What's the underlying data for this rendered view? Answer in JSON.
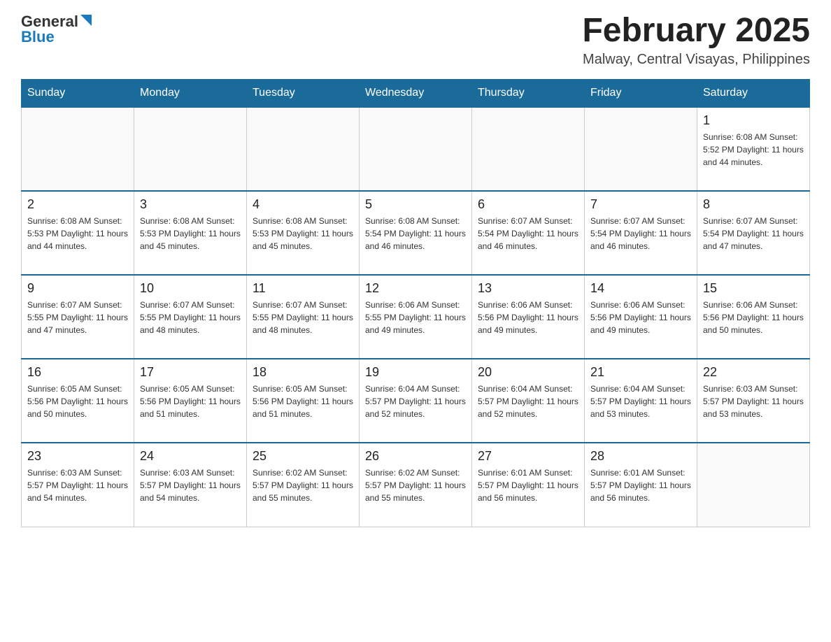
{
  "header": {
    "logo": {
      "general": "General",
      "blue": "Blue"
    },
    "title": "February 2025",
    "subtitle": "Malway, Central Visayas, Philippines"
  },
  "weekdays": [
    "Sunday",
    "Monday",
    "Tuesday",
    "Wednesday",
    "Thursday",
    "Friday",
    "Saturday"
  ],
  "weeks": [
    [
      {
        "day": "",
        "info": ""
      },
      {
        "day": "",
        "info": ""
      },
      {
        "day": "",
        "info": ""
      },
      {
        "day": "",
        "info": ""
      },
      {
        "day": "",
        "info": ""
      },
      {
        "day": "",
        "info": ""
      },
      {
        "day": "1",
        "info": "Sunrise: 6:08 AM\nSunset: 5:52 PM\nDaylight: 11 hours and 44 minutes."
      }
    ],
    [
      {
        "day": "2",
        "info": "Sunrise: 6:08 AM\nSunset: 5:53 PM\nDaylight: 11 hours and 44 minutes."
      },
      {
        "day": "3",
        "info": "Sunrise: 6:08 AM\nSunset: 5:53 PM\nDaylight: 11 hours and 45 minutes."
      },
      {
        "day": "4",
        "info": "Sunrise: 6:08 AM\nSunset: 5:53 PM\nDaylight: 11 hours and 45 minutes."
      },
      {
        "day": "5",
        "info": "Sunrise: 6:08 AM\nSunset: 5:54 PM\nDaylight: 11 hours and 46 minutes."
      },
      {
        "day": "6",
        "info": "Sunrise: 6:07 AM\nSunset: 5:54 PM\nDaylight: 11 hours and 46 minutes."
      },
      {
        "day": "7",
        "info": "Sunrise: 6:07 AM\nSunset: 5:54 PM\nDaylight: 11 hours and 46 minutes."
      },
      {
        "day": "8",
        "info": "Sunrise: 6:07 AM\nSunset: 5:54 PM\nDaylight: 11 hours and 47 minutes."
      }
    ],
    [
      {
        "day": "9",
        "info": "Sunrise: 6:07 AM\nSunset: 5:55 PM\nDaylight: 11 hours and 47 minutes."
      },
      {
        "day": "10",
        "info": "Sunrise: 6:07 AM\nSunset: 5:55 PM\nDaylight: 11 hours and 48 minutes."
      },
      {
        "day": "11",
        "info": "Sunrise: 6:07 AM\nSunset: 5:55 PM\nDaylight: 11 hours and 48 minutes."
      },
      {
        "day": "12",
        "info": "Sunrise: 6:06 AM\nSunset: 5:55 PM\nDaylight: 11 hours and 49 minutes."
      },
      {
        "day": "13",
        "info": "Sunrise: 6:06 AM\nSunset: 5:56 PM\nDaylight: 11 hours and 49 minutes."
      },
      {
        "day": "14",
        "info": "Sunrise: 6:06 AM\nSunset: 5:56 PM\nDaylight: 11 hours and 49 minutes."
      },
      {
        "day": "15",
        "info": "Sunrise: 6:06 AM\nSunset: 5:56 PM\nDaylight: 11 hours and 50 minutes."
      }
    ],
    [
      {
        "day": "16",
        "info": "Sunrise: 6:05 AM\nSunset: 5:56 PM\nDaylight: 11 hours and 50 minutes."
      },
      {
        "day": "17",
        "info": "Sunrise: 6:05 AM\nSunset: 5:56 PM\nDaylight: 11 hours and 51 minutes."
      },
      {
        "day": "18",
        "info": "Sunrise: 6:05 AM\nSunset: 5:56 PM\nDaylight: 11 hours and 51 minutes."
      },
      {
        "day": "19",
        "info": "Sunrise: 6:04 AM\nSunset: 5:57 PM\nDaylight: 11 hours and 52 minutes."
      },
      {
        "day": "20",
        "info": "Sunrise: 6:04 AM\nSunset: 5:57 PM\nDaylight: 11 hours and 52 minutes."
      },
      {
        "day": "21",
        "info": "Sunrise: 6:04 AM\nSunset: 5:57 PM\nDaylight: 11 hours and 53 minutes."
      },
      {
        "day": "22",
        "info": "Sunrise: 6:03 AM\nSunset: 5:57 PM\nDaylight: 11 hours and 53 minutes."
      }
    ],
    [
      {
        "day": "23",
        "info": "Sunrise: 6:03 AM\nSunset: 5:57 PM\nDaylight: 11 hours and 54 minutes."
      },
      {
        "day": "24",
        "info": "Sunrise: 6:03 AM\nSunset: 5:57 PM\nDaylight: 11 hours and 54 minutes."
      },
      {
        "day": "25",
        "info": "Sunrise: 6:02 AM\nSunset: 5:57 PM\nDaylight: 11 hours and 55 minutes."
      },
      {
        "day": "26",
        "info": "Sunrise: 6:02 AM\nSunset: 5:57 PM\nDaylight: 11 hours and 55 minutes."
      },
      {
        "day": "27",
        "info": "Sunrise: 6:01 AM\nSunset: 5:57 PM\nDaylight: 11 hours and 56 minutes."
      },
      {
        "day": "28",
        "info": "Sunrise: 6:01 AM\nSunset: 5:57 PM\nDaylight: 11 hours and 56 minutes."
      },
      {
        "day": "",
        "info": ""
      }
    ]
  ]
}
